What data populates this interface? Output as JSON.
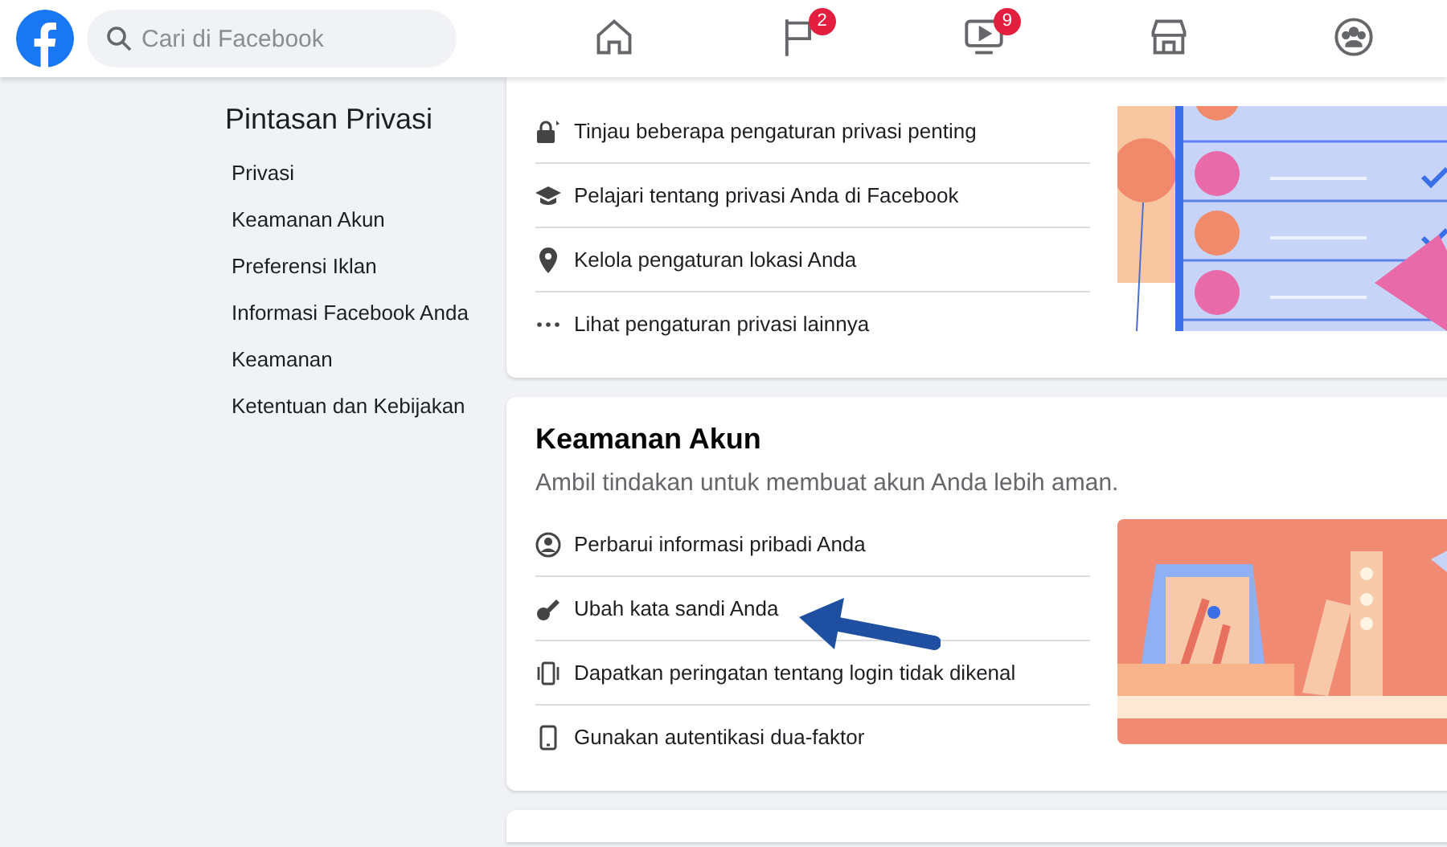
{
  "topbar": {
    "search": {
      "placeholder": "Cari di Facebook"
    },
    "nav": [
      {
        "selected": false
      },
      {
        "selected": false,
        "badge": "2"
      },
      {
        "selected": false,
        "badge": "9"
      },
      {
        "selected": false
      },
      {
        "selected": false
      }
    ]
  },
  "sidebar": {
    "title": "Pintasan Privasi",
    "items": [
      "Privasi",
      "Keamanan Akun",
      "Preferensi Iklan",
      "Informasi Facebook Anda",
      "Keamanan",
      "Ketentuan dan Kebijakan"
    ]
  },
  "cards": [
    {
      "kind": "privacy",
      "items": [
        "Tinjau beberapa pengaturan privasi penting",
        "Pelajari tentang privasi Anda di Facebook",
        "Kelola pengaturan lokasi Anda",
        "Lihat pengaturan privasi lainnya"
      ]
    },
    {
      "kind": "security",
      "title": "Keamanan Akun",
      "subtitle": "Ambil tindakan untuk membuat akun Anda lebih aman.",
      "items": [
        "Perbarui informasi pribadi Anda",
        "Ubah kata sandi Anda",
        "Dapatkan peringatan tentang login tidak dikenal",
        "Gunakan autentikasi dua-faktor"
      ]
    }
  ]
}
